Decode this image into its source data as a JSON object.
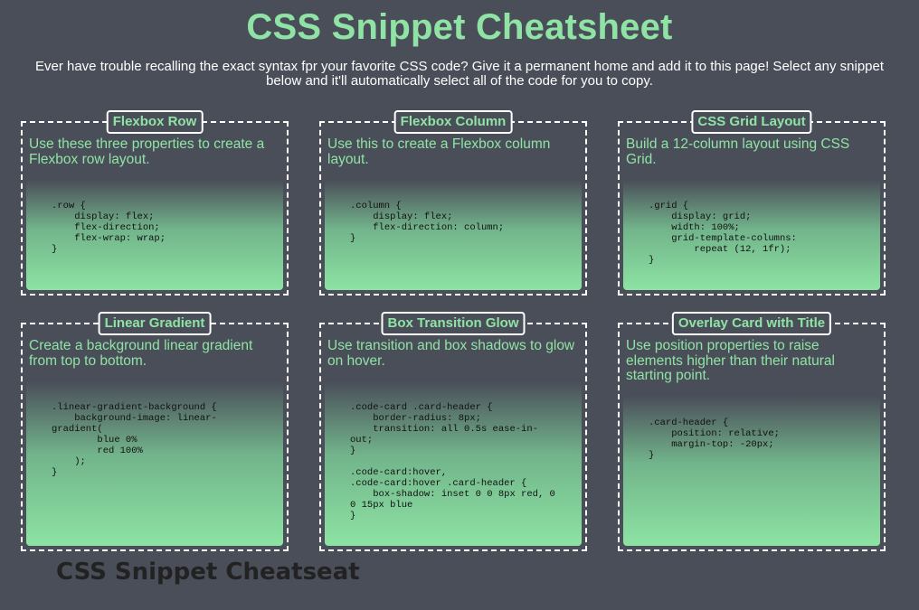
{
  "page": {
    "title": "CSS Snippet Cheatsheet",
    "intro": "Ever have trouble recalling the exact syntax fpr your favorite CSS code? Give it a permanent home and add it to this page! Select any snippet below and it'll automatically select all of the code for you to copy.",
    "footer": "CSS Snippet Cheatseat"
  },
  "colors": {
    "background": "#4a4e59",
    "accent": "#8fe3a4",
    "border": "#ffffff",
    "code_text": "#111111"
  },
  "cards": [
    {
      "title": "Flexbox Row",
      "description": "Use these three properties to create a Flexbox row layout.",
      "code": ".row {\n    display: flex;\n    flex-direction;\n    flex-wrap: wrap;\n}"
    },
    {
      "title": "Flexbox Column",
      "description": "Use this to create a Flexbox column layout.",
      "code": ".column {\n    display: flex;\n    flex-direction: column;\n}"
    },
    {
      "title": "CSS Grid Layout",
      "description": "Build a 12-column layout using CSS Grid.",
      "code": ".grid {\n    display: grid;\n    width: 100%;\n    grid-template-columns:\n        repeat (12, 1fr);\n}"
    },
    {
      "title": "Linear Gradient",
      "description": "Create a background linear gradient from top to bottom.",
      "code": ".linear-gradient-background {\n    background-image: linear-gradient(\n        blue 0%\n        red 100%\n    );\n}"
    },
    {
      "title": "Box Transition Glow",
      "description": "Use transition and box shadows to glow on hover.",
      "code": ".code-card .card-header {\n    border-radius: 8px;\n    transition: all 0.5s ease-in-out;\n}\n\n.code-card:hover,\n.code-card:hover .card-header {\n    box-shadow: inset 0 0 8px red, 0 0 15px blue\n}"
    },
    {
      "title": "Overlay Card with Title",
      "description": "Use position properties to raise elements higher than their natural starting point.",
      "code": ".card-header {\n    position: relative;\n    margin-top: -20px;\n}"
    }
  ]
}
